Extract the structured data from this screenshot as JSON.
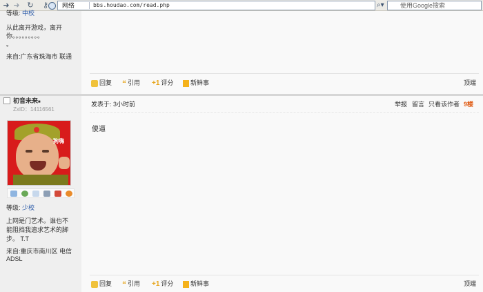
{
  "browser": {
    "address_label": "网络",
    "url": "bbs.houdao.com/read.php",
    "search_placeholder": "使用Google搜索"
  },
  "post1": {
    "level_prefix": "等级:",
    "level_value": "中校",
    "signature_line1": "从此离开游戏，离开",
    "signature_line2": "你。。。。。。。。。",
    "signature_line3": "。",
    "from": "来自:广东省珠海市 联通",
    "actions": {
      "reply": "回复",
      "quote": "引用",
      "rate": "评分",
      "new": "新鲜事"
    },
    "top": "顶端"
  },
  "post2": {
    "username": "初音未来",
    "zxid": "ZxID：14116561",
    "avatar_text": "狗嗨",
    "level_prefix": "等级:",
    "level_value": "少校",
    "signature_line1": "上网是门艺术。谁也不",
    "signature_line2": "能阻挡我追求艺术的脚",
    "signature_line3": "步。 T.T",
    "from_line1": "来自:重庆市南川区 电信",
    "from_line2": "ADSL",
    "posted_at": "发表于: 3小时前",
    "report": "举报",
    "message": "留言",
    "only_author": "只看该作者",
    "floor": "9楼",
    "content": "傻逼",
    "actions": {
      "reply": "回复",
      "quote": "引用",
      "rate": "评分",
      "new": "新鲜事"
    },
    "top": "顶端"
  },
  "colors": {
    "link_blue": "#2a5aa8",
    "floor_orange": "#e05a12",
    "sidebar_bg": "#efefef",
    "main_bg": "#f9f9f9"
  },
  "icons": [
    "back-arrow-icon",
    "forward-arrow-icon",
    "refresh-icon",
    "key-icon",
    "globe-icon",
    "rss-icon",
    "search-icon",
    "reply-icon",
    "quote-icon",
    "rate-icon",
    "news-icon",
    "mail-icon",
    "add-friend-icon",
    "search-user-icon",
    "profile-card-icon",
    "blocks-icon",
    "qq-icon",
    "user-status-icon"
  ]
}
